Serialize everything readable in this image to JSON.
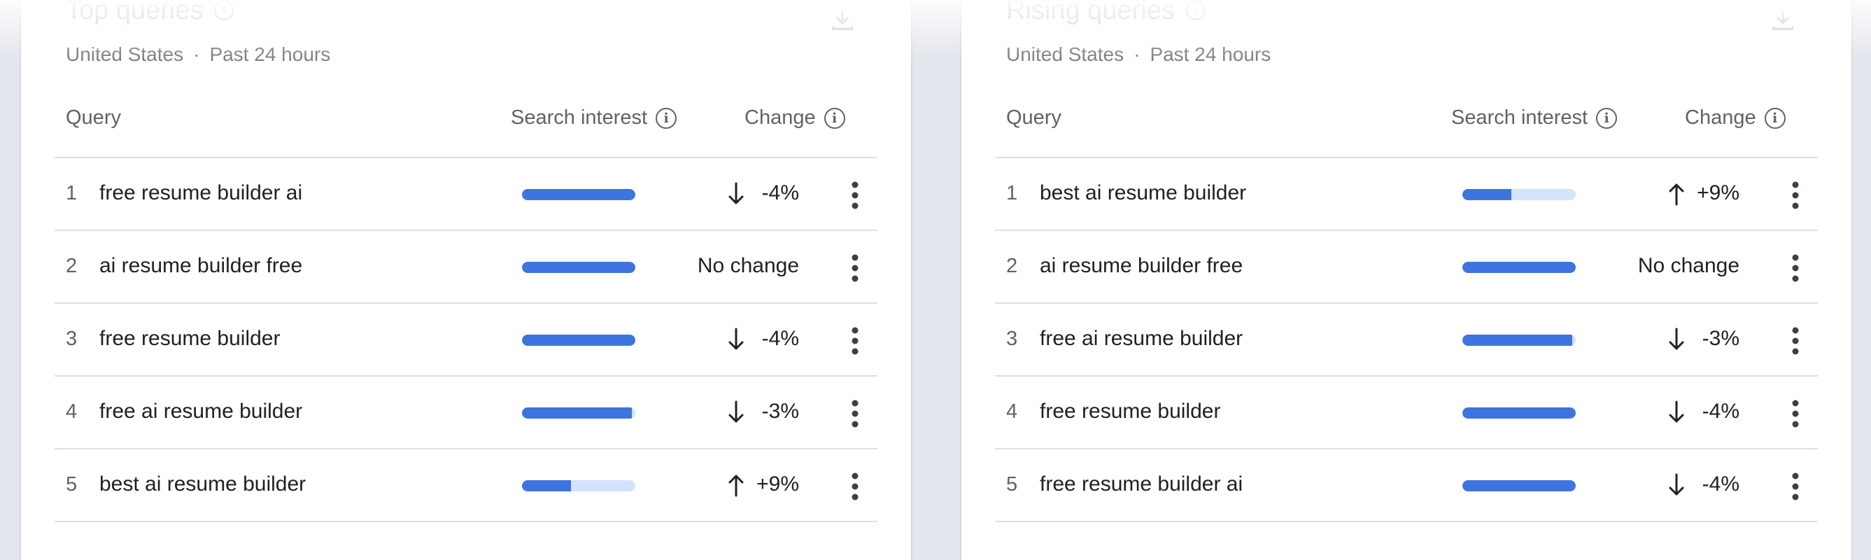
{
  "cards": [
    {
      "id": "left",
      "title": "Top queries",
      "location": "United States",
      "separator": "·",
      "period": "Past 24 hours",
      "headers": {
        "query": "Query",
        "interest": "Search interest",
        "change": "Change"
      },
      "rows": [
        {
          "rank": "1",
          "query": "free resume builder ai",
          "interest": 1.0,
          "direction": "down",
          "change": "-4%"
        },
        {
          "rank": "2",
          "query": "ai resume builder free",
          "interest": 1.0,
          "direction": "none",
          "change": "No change"
        },
        {
          "rank": "3",
          "query": "free resume builder",
          "interest": 1.0,
          "direction": "down",
          "change": "-4%"
        },
        {
          "rank": "4",
          "query": "free ai resume builder",
          "interest": 0.97,
          "direction": "down",
          "change": "-3%"
        },
        {
          "rank": "5",
          "query": "best ai resume builder",
          "interest": 0.43,
          "direction": "up",
          "change": "+9%"
        }
      ]
    },
    {
      "id": "right",
      "title": "Rising queries",
      "location": "United States",
      "separator": "·",
      "period": "Past 24 hours",
      "headers": {
        "query": "Query",
        "interest": "Search interest",
        "change": "Change"
      },
      "rows": [
        {
          "rank": "1",
          "query": "best ai resume builder",
          "interest": 0.43,
          "direction": "up",
          "change": "+9%"
        },
        {
          "rank": "2",
          "query": "ai resume builder free",
          "interest": 1.0,
          "direction": "none",
          "change": "No change"
        },
        {
          "rank": "3",
          "query": "free ai resume builder",
          "interest": 0.97,
          "direction": "down",
          "change": "-3%"
        },
        {
          "rank": "4",
          "query": "free resume builder",
          "interest": 1.0,
          "direction": "down",
          "change": "-4%"
        },
        {
          "rank": "5",
          "query": "free resume builder ai",
          "interest": 1.0,
          "direction": "down",
          "change": "-4%"
        }
      ]
    }
  ],
  "colors": {
    "bar_fill": "#3e74dd",
    "bar_track": "#d2e3fc",
    "text": "#202124",
    "muted": "#5f6368"
  },
  "icons": {
    "info": "info-icon",
    "download": "download-icon",
    "more": "more-vert-icon",
    "up": "arrow-up-icon",
    "down": "arrow-down-icon"
  }
}
